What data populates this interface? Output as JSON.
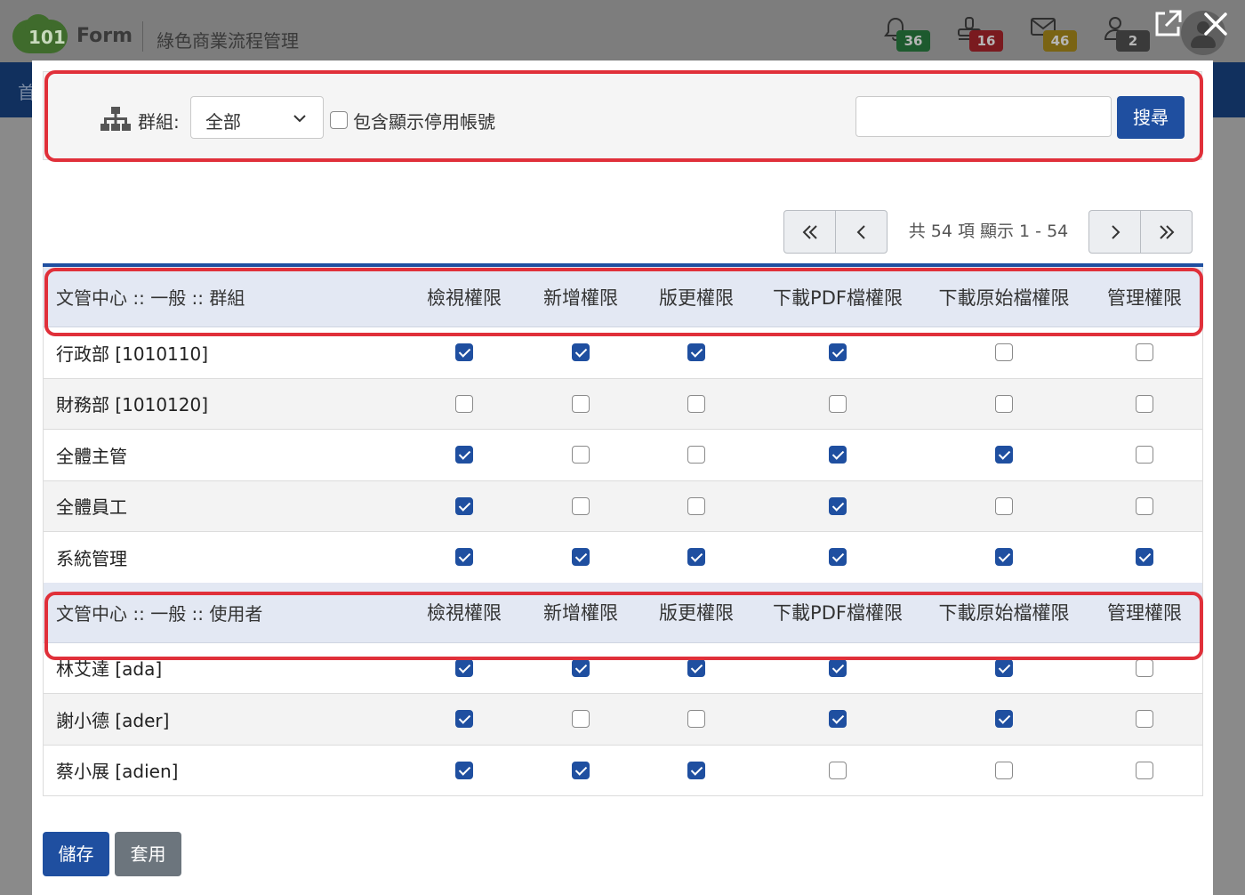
{
  "app": {
    "logo_number": "101",
    "brand": "Form",
    "subtitle": "綠色商業流程管理",
    "nav_partial": "首",
    "notifications": [
      {
        "name": "bell",
        "count": "36",
        "color": "#1d5a2e"
      },
      {
        "name": "stamp",
        "count": "16",
        "color": "#7a1a1f"
      },
      {
        "name": "mail",
        "count": "46",
        "color": "#7a6414"
      },
      {
        "name": "user",
        "count": "2",
        "color": "#3a3a3a"
      }
    ]
  },
  "filter": {
    "group_label": "群組:",
    "group_selected": "全部",
    "include_disabled_label": "包含顯示停用帳號",
    "search_value": "",
    "search_button": "搜尋"
  },
  "pager": {
    "info": "共 54 項 顯示 1 - 54"
  },
  "columns": [
    "檢視權限",
    "新增權限",
    "版更權限",
    "下載PDF檔權限",
    "下載原始檔權限",
    "管理權限"
  ],
  "sections": [
    {
      "title": "文管中心 :: 一般 :: 群組",
      "rows": [
        {
          "name": "行政部 [1010110]",
          "perms": [
            true,
            true,
            true,
            true,
            false,
            false
          ]
        },
        {
          "name": "財務部 [1010120]",
          "perms": [
            false,
            false,
            false,
            false,
            false,
            false
          ]
        },
        {
          "name": "全體主管",
          "perms": [
            true,
            false,
            false,
            true,
            true,
            false
          ]
        },
        {
          "name": "全體員工",
          "perms": [
            true,
            false,
            false,
            true,
            false,
            false
          ]
        },
        {
          "name": "系統管理",
          "perms": [
            true,
            true,
            true,
            true,
            true,
            true
          ]
        }
      ]
    },
    {
      "title": "文管中心 :: 一般 :: 使用者",
      "rows": [
        {
          "name": "林艾達 [ada]",
          "perms": [
            true,
            true,
            true,
            true,
            true,
            false
          ]
        },
        {
          "name": "謝小德 [ader]",
          "perms": [
            true,
            false,
            false,
            true,
            true,
            false
          ]
        },
        {
          "name": "蔡小展 [adien]",
          "perms": [
            true,
            true,
            true,
            false,
            false,
            false
          ]
        }
      ]
    }
  ],
  "footer": {
    "save": "儲存",
    "apply": "套用"
  },
  "colors": {
    "primary": "#1f4fa0",
    "secondary": "#6c757d",
    "highlight": "#e0303a",
    "header_bg": "#e3e8f3"
  }
}
